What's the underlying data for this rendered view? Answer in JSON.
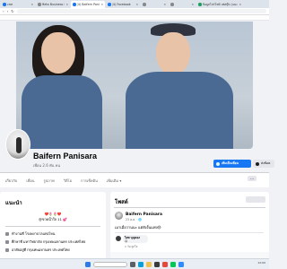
{
  "browser": {
    "tabs": [
      {
        "label": "แชท",
        "active": false,
        "icon": "facebook-icon"
      },
      {
        "label": "Meta Business Suite",
        "active": false,
        "icon": "meta-icon"
      },
      {
        "label": "(4) Baifern Panisara | Facebook",
        "active": true,
        "icon": "facebook-icon"
      },
      {
        "label": "(4) Facebook",
        "active": false,
        "icon": "facebook-icon"
      },
      {
        "label": "",
        "active": false,
        "icon": "page-icon"
      },
      {
        "label": "",
        "active": false,
        "icon": "page-icon"
      },
      {
        "label": "ข้อมูลโปรไฟล์ เฟสบุ๊ค (แนะนำ)",
        "active": false,
        "icon": "page-icon"
      }
    ]
  },
  "profile": {
    "name": "Baifern Panisara",
    "friends": "เพื่อน 2.6 พัน คน",
    "add_friend_label": "เพิ่มเป็นเพื่อน",
    "message_label": "ส่งข้อค"
  },
  "nav": {
    "tabs": [
      "เกี่ยวกับ",
      "เพื่อน",
      "รูปภาพ",
      "วิดีโอ",
      "การเช็คอิน",
      "เพิ่มเติม ▾"
    ],
    "more": "···"
  },
  "intro": {
    "title": "แนะนำ",
    "bio_line1": "❤️🌷🌷❤️",
    "bio_line2": "@ขวดน้ำใจ 11 💕",
    "lines": [
      "ทำงานที่ โรงพยาบาลแห่งไหน",
      "ศึกษาที่ มหาวิทยาลัย กรุงเทพมหานคร ประเทศไทย",
      "อาศัยอยู่ที่ กรุงเทพมหานคร ประเทศไทย"
    ]
  },
  "posts": {
    "title": "โพสต์",
    "author": "Baifern Panisara",
    "time": "23 ต.ค. · 🌐",
    "text": "เมาเมื่อวานนะ แต่ยังงั้นแฟง😄",
    "comment_author": "ไผท บุญมอง",
    "comment_emoji": "😊",
    "comment_meta": "1 วัน   ถูกใจ"
  },
  "taskbar": {
    "icons": [
      "windows-icon",
      "search-icon",
      "task-view-icon",
      "edge-icon",
      "files-icon",
      "store-icon",
      "chrome-icon",
      "line-icon",
      "zoom-icon"
    ],
    "clock": "12:00"
  },
  "colors": {
    "brand": "#1877f2",
    "background": "#f0f2f5"
  }
}
